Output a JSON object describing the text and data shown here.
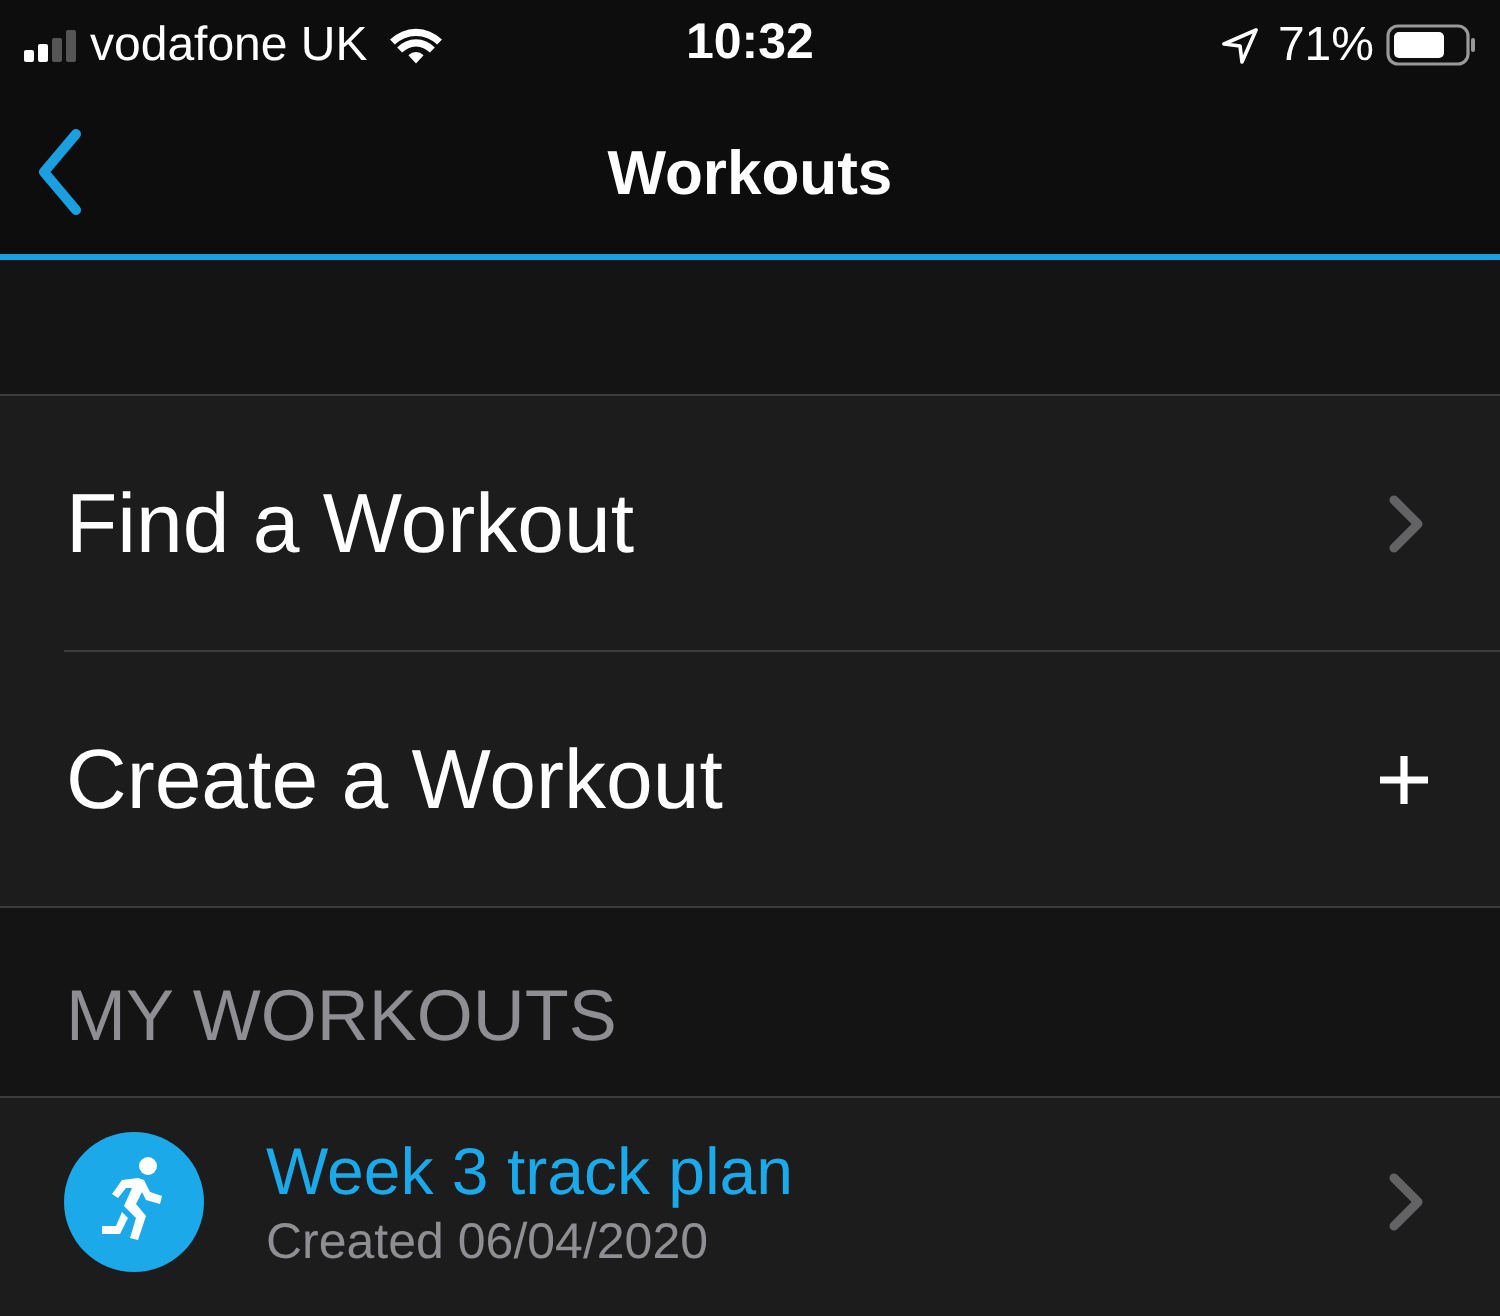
{
  "status_bar": {
    "carrier": "vodafone UK",
    "time": "10:32",
    "battery_percent": "71%"
  },
  "nav_bar": {
    "title": "Workouts"
  },
  "menu_items": [
    {
      "label": "Find a Workout",
      "kind": "chevron"
    },
    {
      "label": "Create a Workout",
      "kind": "add"
    }
  ],
  "my_workouts": {
    "header": "MY WORKOUTS",
    "items": [
      {
        "title": "Week 3 track plan",
        "subtitle": "Created 06/04/2020"
      }
    ]
  }
}
